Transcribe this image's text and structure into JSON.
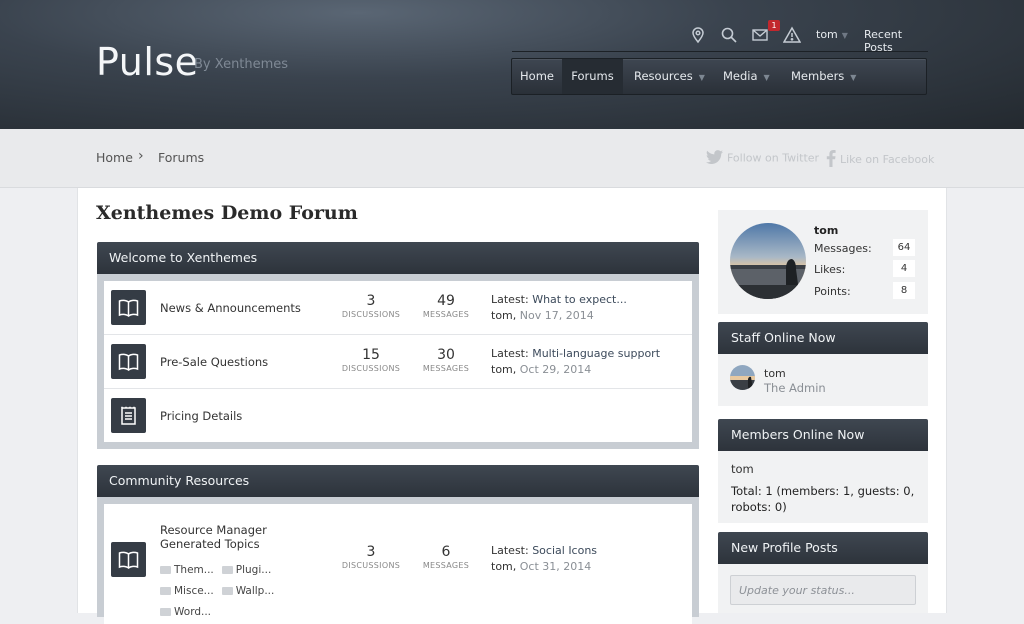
{
  "header": {
    "logo": "Pulse",
    "tagline": "By Xenthemes",
    "inbox_badge": "1",
    "user": "tom",
    "recent_posts": "Recent Posts",
    "icons": [
      "map-pin-icon",
      "search-icon",
      "mail-icon",
      "alert-icon"
    ]
  },
  "nav": {
    "items": [
      {
        "label": "Home",
        "dropdown": false
      },
      {
        "label": "Forums",
        "active": true,
        "dropdown": false
      },
      {
        "label": "Resources",
        "dropdown": true
      },
      {
        "label": "Media",
        "dropdown": true
      },
      {
        "label": "Members",
        "dropdown": true
      }
    ]
  },
  "breadcrumb": {
    "home": "Home",
    "separator": "›",
    "current": "Forums"
  },
  "social": {
    "twitter": "Follow on Twitter",
    "facebook": "Like on Facebook"
  },
  "page": {
    "title": "Xenthemes Demo Forum"
  },
  "categories": [
    {
      "title": "Welcome to Xenthemes",
      "nodes": [
        {
          "title": "News & Announcements",
          "icon": "book-icon",
          "discussions": "3",
          "messages": "49",
          "latest_label": "Latest:",
          "latest_title": "What to expect...",
          "latest_user": "tom",
          "latest_date": "Nov 17, 2014"
        },
        {
          "title": "Pre-Sale Questions",
          "icon": "book-icon",
          "discussions": "15",
          "messages": "30",
          "latest_label": "Latest:",
          "latest_title": "Multi-language support",
          "latest_user": "tom",
          "latest_date": "Oct 29, 2014"
        },
        {
          "title": "Pricing Details",
          "icon": "page-icon"
        }
      ]
    },
    {
      "title": "Community Resources",
      "nodes": [
        {
          "title": "Resource Manager Generated Topics",
          "icon": "book-icon",
          "discussions": "3",
          "messages": "6",
          "latest_label": "Latest:",
          "latest_title": "Social Icons",
          "latest_user": "tom",
          "latest_date": "Oct 31, 2014",
          "subforums": [
            "Them...",
            "Plugi...",
            "Misce...",
            "Wallp...",
            "Word..."
          ]
        }
      ]
    }
  ],
  "stat_labels": {
    "discussions": "DISCUSSIONS",
    "messages": "MESSAGES"
  },
  "visitor": {
    "name": "tom",
    "messages_label": "Messages:",
    "messages": "64",
    "likes_label": "Likes:",
    "likes": "4",
    "points_label": "Points:",
    "points": "8"
  },
  "staff_online": {
    "title": "Staff Online Now",
    "name": "tom",
    "role": "The Admin"
  },
  "members_online": {
    "title": "Members Online Now",
    "name": "tom",
    "total": "Total: 1 (members: 1, guests: 0, robots: 0)"
  },
  "profile_posts": {
    "title": "New Profile Posts",
    "placeholder": "Update your status..."
  },
  "colors": {
    "header_dark": "#2d333b",
    "badge": "#c2272d",
    "content_bg": "#ffffff"
  }
}
